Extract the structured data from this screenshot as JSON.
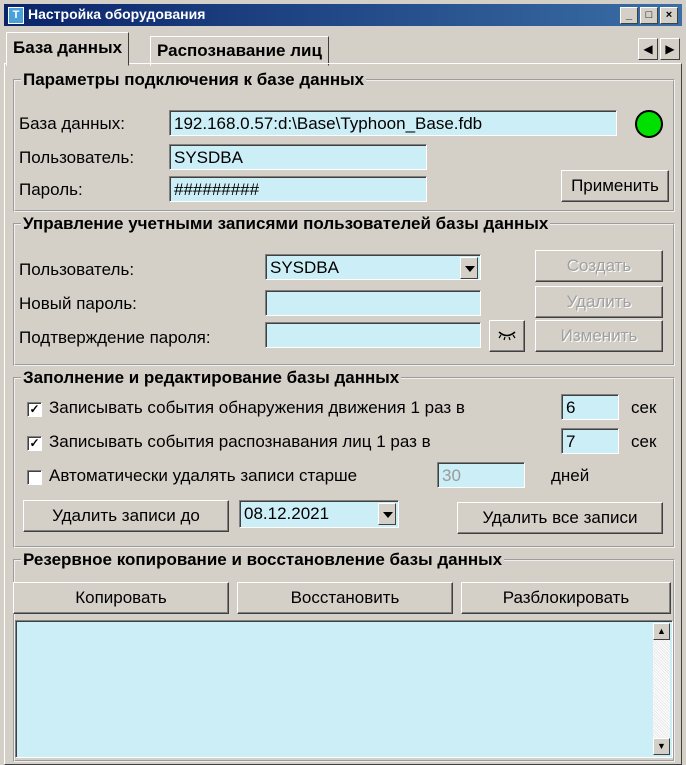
{
  "window": {
    "title": "Настройка оборудования",
    "icon_letter": "T",
    "controls": [
      "_",
      "□",
      "×"
    ]
  },
  "tabs": [
    {
      "label": "База данных",
      "active": true
    },
    {
      "label": "Распознавание лиц",
      "active": false
    }
  ],
  "tab_scroll": {
    "left": "◀",
    "right": "▶"
  },
  "connection": {
    "legend": "Параметры подключения к базе данных",
    "db_label": "База данных:",
    "db_value": "192.168.0.57:d:\\Base\\Typhoon_Base.fdb",
    "user_label": "Пользователь:",
    "user_value": "SYSDBA",
    "password_label": "Пароль:",
    "password_value": "#########",
    "apply_button": "Применить",
    "status_color": "#00e000"
  },
  "accounts": {
    "legend": "Управление учетными записями пользователей базы данных",
    "user_label": "Пользователь:",
    "user_selected": "SYSDBA",
    "new_password_label": "Новый пароль:",
    "new_password_value": "",
    "confirm_label": "Подтверждение пароля:",
    "confirm_value": "",
    "show_password_icon": "eye-icon",
    "create_button": "Создать",
    "delete_button": "Удалить",
    "change_button": "Изменить"
  },
  "fill": {
    "legend": "Заполнение и редактирование базы данных",
    "motion_label": "Записывать события обнаружения движения 1 раз в",
    "motion_checked": true,
    "motion_value": "6",
    "motion_unit": "сек",
    "face_label": "Записывать события распознавания лиц 1 раз в",
    "face_checked": true,
    "face_value": "7",
    "face_unit": "сек",
    "autodelete_label": "Автоматически удалять записи старше",
    "autodelete_checked": false,
    "autodelete_value": "30",
    "autodelete_unit": "дней",
    "delete_until_button": "Удалить записи до",
    "delete_until_date": "08.12.2021",
    "delete_all_button": "Удалить все записи"
  },
  "backup": {
    "legend": "Резервное копирование и восстановление базы данных",
    "copy_button": "Копировать",
    "restore_button": "Восстановить",
    "unlock_button": "Разблокировать",
    "log_text": "",
    "scroll_up": "▲",
    "scroll_down": "▼"
  },
  "colors": {
    "input_bg": "#cceef6",
    "window_bg": "#d4d0c8",
    "titlebar": "#0a246a"
  }
}
